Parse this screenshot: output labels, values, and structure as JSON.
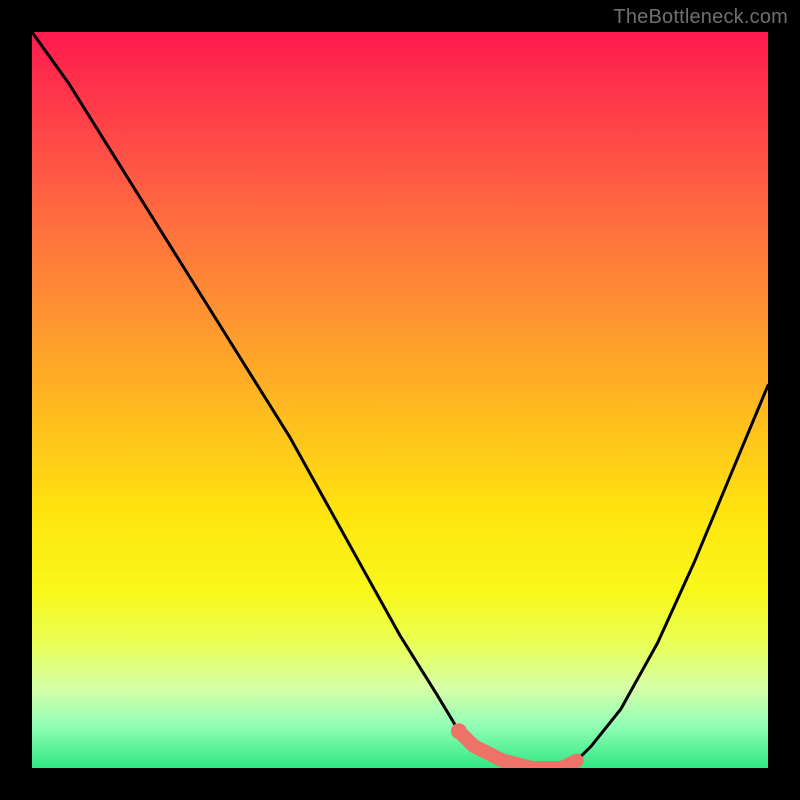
{
  "watermark": "TheBottleneck.com",
  "chart_data": {
    "type": "line",
    "title": "",
    "xlabel": "",
    "ylabel": "",
    "xlim": [
      0,
      100
    ],
    "ylim": [
      0,
      100
    ],
    "series": [
      {
        "name": "bottleneck-curve",
        "x": [
          0,
          5,
          10,
          15,
          20,
          25,
          30,
          35,
          40,
          45,
          50,
          55,
          58,
          60,
          64,
          68,
          72,
          74,
          76,
          80,
          85,
          90,
          95,
          100
        ],
        "y": [
          100,
          93,
          85,
          77,
          69,
          61,
          53,
          45,
          36,
          27,
          18,
          10,
          5,
          3,
          1,
          0,
          0,
          1,
          3,
          8,
          17,
          28,
          40,
          52
        ]
      }
    ],
    "highlight_segment": {
      "name": "optimal-range",
      "x": [
        58,
        60,
        64,
        68,
        72,
        74
      ],
      "y": [
        5,
        3,
        1,
        0,
        0,
        1
      ]
    },
    "highlight_point": {
      "x": 58,
      "y": 5
    },
    "colors": {
      "curve": "#000000",
      "highlight": "#ed7267",
      "gradient_top": "#ff1a4d",
      "gradient_mid": "#ffe60f",
      "gradient_bottom": "#2fe883",
      "frame": "#000000",
      "watermark": "#6f6f6f"
    }
  }
}
